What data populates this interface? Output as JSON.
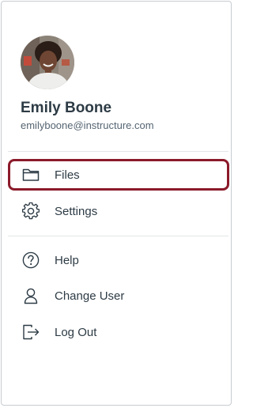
{
  "profile": {
    "name": "Emily Boone",
    "email": "emilyboone@instructure.com"
  },
  "menu": {
    "files": {
      "label": "Files",
      "icon": "folder-icon"
    },
    "settings": {
      "label": "Settings",
      "icon": "gear-icon"
    },
    "help": {
      "label": "Help",
      "icon": "help-icon"
    },
    "change_user": {
      "label": "Change User",
      "icon": "user-icon"
    },
    "log_out": {
      "label": "Log Out",
      "icon": "logout-icon"
    }
  },
  "colors": {
    "text": "#2d3b45",
    "highlight_border": "#8b1a2a",
    "divider": "#e3e6e8"
  }
}
